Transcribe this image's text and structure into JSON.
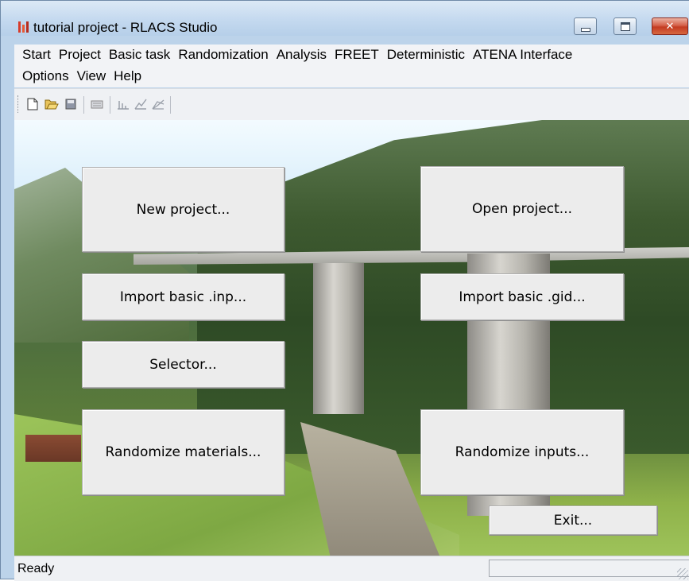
{
  "window": {
    "title": "tutorial project - RLACS Studio",
    "controls": {
      "minimize": "minimize",
      "maximize": "maximize",
      "close": "✕"
    }
  },
  "menu": {
    "row1": [
      "Start",
      "Project",
      "Basic task",
      "Randomization",
      "Analysis",
      "FREET",
      "Deterministic",
      "ATENA Interface"
    ],
    "row2": [
      "Options",
      "View",
      "Help"
    ]
  },
  "toolbar": {
    "icons": [
      "new-file-icon",
      "open-folder-icon",
      "save-icon",
      "keyboard-icon",
      "histogram-icon",
      "chart-fit-icon",
      "chart-compare-icon"
    ]
  },
  "buttons": {
    "new_project": "New project...",
    "open_project": "Open project...",
    "import_inp": "Import basic .inp...",
    "import_gid": "Import basic .gid...",
    "selector": "Selector...",
    "randomize_materials": "Randomize materials...",
    "randomize_inputs": "Randomize inputs...",
    "exit": "Exit..."
  },
  "status": {
    "text": "Ready",
    "pane": ""
  },
  "colors": {
    "title_bar": "#c4d9ef",
    "close_button": "#c43b22",
    "button_face": "#ececec"
  }
}
